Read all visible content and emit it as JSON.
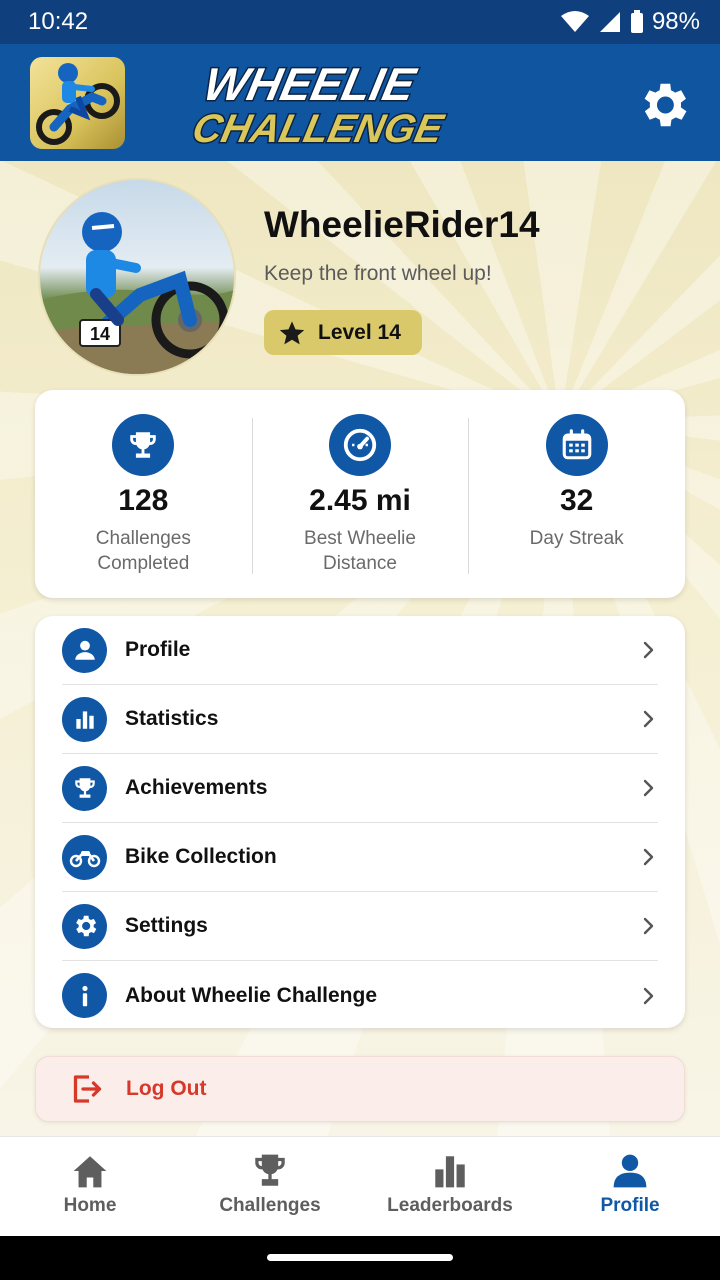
{
  "status_bar": {
    "time": "10:42",
    "battery": "98%"
  },
  "header": {
    "title_line1": "WHEELIE",
    "title_line2": "CHALLENGE",
    "settings_icon": "gear-icon"
  },
  "profile": {
    "username": "WheelieRider14",
    "tagline": "Keep the front wheel up!",
    "level": "Level 14",
    "bike_number": "14"
  },
  "stats": [
    {
      "icon": "trophy-icon",
      "value": "128",
      "label": "Challenges Completed"
    },
    {
      "icon": "speedometer-icon",
      "value": "2.45 mi",
      "label": "Best Wheelie Distance"
    },
    {
      "icon": "calendar-icon",
      "value": "32",
      "label": "Day Streak"
    }
  ],
  "menu": [
    {
      "icon": "user-icon",
      "label": "Profile"
    },
    {
      "icon": "bar-chart-icon",
      "label": "Statistics"
    },
    {
      "icon": "trophy-icon",
      "label": "Achievements"
    },
    {
      "icon": "motorcycle-icon",
      "label": "Bike Collection"
    },
    {
      "icon": "gear-icon",
      "label": "Settings"
    },
    {
      "icon": "info-icon",
      "label": "About Wheelie Challenge"
    }
  ],
  "logout": {
    "label": "Log Out",
    "icon": "logout-icon"
  },
  "bottom_nav": [
    {
      "icon": "home-icon",
      "label": "Home",
      "active": false
    },
    {
      "icon": "trophy-icon",
      "label": "Challenges",
      "active": false
    },
    {
      "icon": "bar-chart-icon",
      "label": "Leaderboards",
      "active": false
    },
    {
      "icon": "user-icon",
      "label": "Profile",
      "active": true
    }
  ],
  "colors": {
    "primary": "#1057a5",
    "header": "#0f55a0",
    "status_bar": "#0f3f7c",
    "accent_gold": "#d9c96a",
    "logout_red": "#d6382a"
  }
}
